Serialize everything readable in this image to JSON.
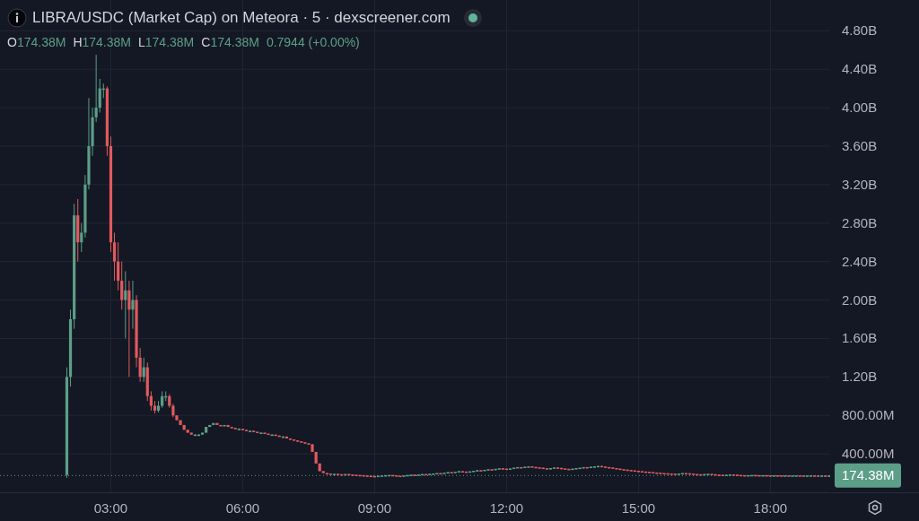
{
  "header": {
    "title": "LIBRA/USDC (Market Cap) on Meteora · 5 · dexscreener.com",
    "ohlc": [
      {
        "label": "O",
        "value": "174.38M"
      },
      {
        "label": "H",
        "value": "174.38M"
      },
      {
        "label": "L",
        "value": "174.38M"
      },
      {
        "label": "C",
        "value": "174.38M"
      }
    ],
    "change": "0.7944 (+0.00%)"
  },
  "price_badge": "174.38M",
  "chart_data": {
    "type": "candlestick",
    "xlim": [
      0.48,
      21.38
    ],
    "grid": true,
    "ylim": [
      0,
      5120000000.0
    ],
    "xticks": [
      {
        "value": 3,
        "label": "03:00"
      },
      {
        "value": 6,
        "label": "06:00"
      },
      {
        "value": 9,
        "label": "09:00"
      },
      {
        "value": 12,
        "label": "12:00"
      },
      {
        "value": 15,
        "label": "15:00"
      },
      {
        "value": 18,
        "label": "18:00"
      }
    ],
    "yticks": [
      {
        "value": 400000000.0,
        "label": "400.00M"
      },
      {
        "value": 800000000.0,
        "label": "800.00M"
      },
      {
        "value": 1200000000.0,
        "label": "1.20B"
      },
      {
        "value": 1600000000.0,
        "label": "1.60B"
      },
      {
        "value": 2000000000.0,
        "label": "2.00B"
      },
      {
        "value": 2400000000.0,
        "label": "2.40B"
      },
      {
        "value": 2800000000.0,
        "label": "2.80B"
      },
      {
        "value": 3200000000.0,
        "label": "3.20B"
      },
      {
        "value": 3600000000.0,
        "label": "3.60B"
      },
      {
        "value": 4000000000.0,
        "label": "4.00B"
      },
      {
        "value": 4400000000.0,
        "label": "4.40B"
      },
      {
        "value": 4800000000.0,
        "label": "4.80B"
      }
    ],
    "x": [
      2,
      2.083,
      2.167,
      2.25,
      2.333,
      2.417,
      2.5,
      2.583,
      2.667,
      2.75,
      2.833,
      2.917,
      3,
      3.083,
      3.167,
      3.25,
      3.333,
      3.417,
      3.5,
      3.583,
      3.667,
      3.75,
      3.833,
      3.917,
      4,
      4.083,
      4.167,
      4.25,
      4.333,
      4.417,
      4.5,
      4.583,
      4.667,
      4.75,
      4.833,
      4.917,
      5,
      5.083,
      5.167,
      5.25,
      5.333,
      5.417,
      5.5,
      5.583,
      5.667,
      5.75,
      5.833,
      5.917,
      6,
      6.083,
      6.167,
      6.25,
      6.333,
      6.417,
      6.5,
      6.583,
      6.667,
      6.75,
      6.833,
      6.917,
      7,
      7.083,
      7.167,
      7.25,
      7.333,
      7.417,
      7.5,
      7.583,
      7.667,
      7.75,
      7.833,
      7.917,
      8,
      8.083,
      8.167,
      8.25,
      8.333,
      8.417,
      8.5,
      8.583,
      8.667,
      8.75,
      8.833,
      8.917,
      9,
      9.083,
      9.167,
      9.25,
      9.333,
      9.417,
      9.5,
      9.583,
      9.667,
      9.75,
      9.833,
      9.917,
      10,
      10.083,
      10.167,
      10.25,
      10.333,
      10.417,
      10.5,
      10.583,
      10.667,
      10.75,
      10.833,
      10.917,
      11,
      11.083,
      11.167,
      11.25,
      11.333,
      11.417,
      11.5,
      11.583,
      11.667,
      11.75,
      11.833,
      11.917,
      12,
      12.083,
      12.167,
      12.25,
      12.333,
      12.417,
      12.5,
      12.583,
      12.667,
      12.75,
      12.833,
      12.917,
      13,
      13.083,
      13.167,
      13.25,
      13.333,
      13.417,
      13.5,
      13.583,
      13.667,
      13.75,
      13.833,
      13.917,
      14,
      14.083,
      14.167,
      14.25,
      14.333,
      14.417,
      14.5,
      14.583,
      14.667,
      14.75,
      14.833,
      14.917,
      15,
      15.083,
      15.167,
      15.25,
      15.333,
      15.417,
      15.5,
      15.583,
      15.667,
      15.75,
      15.833,
      15.917,
      16,
      16.083,
      16.167,
      16.25,
      16.333,
      16.417,
      16.5,
      16.583,
      16.667,
      16.75,
      16.833,
      16.917,
      17,
      17.083,
      17.167,
      17.25,
      17.333,
      17.417,
      17.5,
      17.583,
      17.667,
      17.75,
      17.833,
      17.917,
      18,
      18.083,
      18.167,
      18.25,
      18.333,
      18.417,
      18.5,
      18.583,
      18.667,
      18.75,
      18.833,
      18.917,
      19,
      19.083,
      19.167,
      19.25,
      19.333
    ],
    "ohlc": [
      [
        180000000.0,
        1300000000.0,
        150000000.0,
        1200000000.0
      ],
      [
        1200000000.0,
        1900000000.0,
        1100000000.0,
        1800000000.0
      ],
      [
        1800000000.0,
        3000000000.0,
        1700000000.0,
        2880000000.0
      ],
      [
        2880000000.0,
        3050000000.0,
        2400000000.0,
        2600000000.0
      ],
      [
        2600000000.0,
        2800000000.0,
        2500000000.0,
        2700000000.0
      ],
      [
        2700000000.0,
        3300000000.0,
        2650000000.0,
        3200000000.0
      ],
      [
        3200000000.0,
        4100000000.0,
        3150000000.0,
        3600000000.0
      ],
      [
        3600000000.0,
        4000000000.0,
        3500000000.0,
        3900000000.0
      ],
      [
        3900000000.0,
        4550000000.0,
        3850000000.0,
        4000000000.0
      ],
      [
        4000000000.0,
        4300000000.0,
        3950000000.0,
        4200000000.0
      ],
      [
        4200000000.0,
        4250000000.0,
        4100000000.0,
        4200000000.0
      ],
      [
        4200000000.0,
        4220000000.0,
        3500000000.0,
        3600000000.0
      ],
      [
        3600000000.0,
        3700000000.0,
        2500000000.0,
        2600000000.0
      ],
      [
        2600000000.0,
        2700000000.0,
        2200000000.0,
        2400000000.0
      ],
      [
        2400000000.0,
        2600000000.0,
        2100000000.0,
        2200000000.0
      ],
      [
        2200000000.0,
        2400000000.0,
        1900000000.0,
        2000000000.0
      ],
      [
        2000000000.0,
        2300000000.0,
        1600000000.0,
        2100000000.0
      ],
      [
        2100000000.0,
        2200000000.0,
        1200000000.0,
        1900000000.0
      ],
      [
        1900000000.0,
        2200000000.0,
        1700000000.0,
        2000000000.0
      ],
      [
        2000000000.0,
        2050000000.0,
        1300000000.0,
        1400000000.0
      ],
      [
        1400000000.0,
        1500000000.0,
        1150000000.0,
        1200000000.0
      ],
      [
        1200000000.0,
        1400000000.0,
        1150000000.0,
        1300000000.0
      ],
      [
        1300000000.0,
        1350000000.0,
        950000000.0,
        1000000000.0
      ],
      [
        1000000000.0,
        1050000000.0,
        850000000.0,
        900000000.0
      ],
      [
        900000000.0,
        950000000.0,
        820000000.0,
        850000000.0
      ],
      [
        850000000.0,
        950000000.0,
        830000000.0,
        900000000.0
      ],
      [
        900000000.0,
        1050000000.0,
        880000000.0,
        1000000000.0
      ],
      [
        1000000000.0,
        1050000000.0,
        950000000.0,
        1000000000.0
      ],
      [
        1000000000.0,
        1020000000.0,
        880000000.0,
        900000000.0
      ],
      [
        900000000.0,
        920000000.0,
        780000000.0,
        800000000.0
      ],
      [
        800000000.0,
        800000000.0,
        750000000.0,
        750000000.0
      ],
      [
        750000000.0,
        750000000.0,
        700000000.0,
        700000000.0
      ],
      [
        700000000.0,
        700000000.0,
        650000000.0,
        650000000.0
      ],
      [
        650000000.0,
        650000000.0,
        620000000.0,
        620000000.0
      ],
      [
        620000000.0,
        620000000.0,
        600000000.0,
        600000000.0
      ],
      [
        600000000.0,
        605000000.0,
        595000000.0,
        600000000.0
      ],
      [
        600000000.0,
        605000000.0,
        595000000.0,
        600000000.0
      ],
      [
        600000000.0,
        620000000.0,
        600000000.0,
        620000000.0
      ],
      [
        620000000.0,
        680000000.0,
        620000000.0,
        680000000.0
      ],
      [
        680000000.0,
        700000000.0,
        680000000.0,
        700000000.0
      ],
      [
        700000000.0,
        720000000.0,
        700000000.0,
        720000000.0
      ],
      [
        720000000.0,
        720000000.0,
        700000000.0,
        700000000.0
      ],
      [
        700000000.0,
        700000000.0,
        690000000.0,
        690000000.0
      ],
      [
        690000000.0,
        700000000.0,
        690000000.0,
        700000000.0
      ],
      [
        700000000.0,
        700000000.0,
        680000000.0,
        680000000.0
      ],
      [
        680000000.0,
        680000000.0,
        670000000.0,
        670000000.0
      ],
      [
        670000000.0,
        670000000.0,
        660000000.0,
        660000000.0
      ],
      [
        660000000.0,
        665000000.0,
        655000000.0,
        660000000.0
      ],
      [
        660000000.0,
        660000000.0,
        650000000.0,
        650000000.0
      ],
      [
        650000000.0,
        650000000.0,
        640000000.0,
        640000000.0
      ],
      [
        640000000.0,
        645000000.0,
        635000000.0,
        640000000.0
      ],
      [
        640000000.0,
        640000000.0,
        630000000.0,
        630000000.0
      ],
      [
        630000000.0,
        630000000.0,
        620000000.0,
        620000000.0
      ],
      [
        620000000.0,
        625000000.0,
        615000000.0,
        620000000.0
      ],
      [
        620000000.0,
        620000000.0,
        610000000.0,
        610000000.0
      ],
      [
        610000000.0,
        610000000.0,
        600000000.0,
        600000000.0
      ],
      [
        600000000.0,
        605000000.0,
        595000000.0,
        600000000.0
      ],
      [
        600000000.0,
        600000000.0,
        590000000.0,
        590000000.0
      ],
      [
        590000000.0,
        590000000.0,
        580000000.0,
        580000000.0
      ],
      [
        580000000.0,
        585000000.0,
        575000000.0,
        580000000.0
      ],
      [
        580000000.0,
        580000000.0,
        560000000.0,
        560000000.0
      ],
      [
        560000000.0,
        560000000.0,
        550000000.0,
        550000000.0
      ],
      [
        550000000.0,
        550000000.0,
        540000000.0,
        540000000.0
      ],
      [
        540000000.0,
        540000000.0,
        530000000.0,
        530000000.0
      ],
      [
        530000000.0,
        530000000.0,
        520000000.0,
        520000000.0
      ],
      [
        520000000.0,
        520000000.0,
        510000000.0,
        510000000.0
      ],
      [
        510000000.0,
        510000000.0,
        500000000.0,
        500000000.0
      ],
      [
        500000000.0,
        500000000.0,
        420000000.0,
        420000000.0
      ],
      [
        420000000.0,
        420000000.0,
        300000000.0,
        300000000.0
      ],
      [
        300000000.0,
        300000000.0,
        220000000.0,
        220000000.0
      ],
      [
        220000000.0,
        220000000.0,
        200000000.0,
        200000000.0
      ],
      [
        200000000.0,
        200000000.0,
        195000000.0,
        195000000.0
      ],
      [
        195000000.0,
        195000000.0,
        190000000.0,
        190000000.0
      ],
      [
        190000000.0,
        192000000.0,
        190000000.0,
        192000000.0
      ],
      [
        192000000.0,
        192000000.0,
        188000000.0,
        188000000.0
      ],
      [
        188000000.0,
        188000000.0,
        185000000.0,
        185000000.0
      ],
      [
        185000000.0,
        190000000.0,
        185000000.0,
        190000000.0
      ],
      [
        190000000.0,
        190000000.0,
        186000000.0,
        186000000.0
      ],
      [
        186000000.0,
        186000000.0,
        182000000.0,
        182000000.0
      ],
      [
        182000000.0,
        182000000.0,
        180000000.0,
        180000000.0
      ],
      [
        180000000.0,
        180000000.0,
        178000000.0,
        178000000.0
      ],
      [
        178000000.0,
        178000000.0,
        175000000.0,
        175000000.0
      ],
      [
        175000000.0,
        175000000.0,
        172000000.0,
        172000000.0
      ],
      [
        172000000.0,
        172000000.0,
        170000000.0,
        170000000.0
      ],
      [
        170000000.0,
        170000000.0,
        168000000.0,
        168000000.0
      ],
      [
        168000000.0,
        172000000.0,
        168000000.0,
        172000000.0
      ],
      [
        172000000.0,
        175000000.0,
        172000000.0,
        175000000.0
      ],
      [
        175000000.0,
        178000000.0,
        175000000.0,
        178000000.0
      ],
      [
        178000000.0,
        180000000.0,
        178000000.0,
        180000000.0
      ],
      [
        180000000.0,
        180000000.0,
        176000000.0,
        176000000.0
      ],
      [
        176000000.0,
        176000000.0,
        172000000.0,
        172000000.0
      ],
      [
        172000000.0,
        172000000.0,
        170000000.0,
        170000000.0
      ],
      [
        170000000.0,
        175000000.0,
        170000000.0,
        175000000.0
      ],
      [
        175000000.0,
        180000000.0,
        175000000.0,
        180000000.0
      ],
      [
        180000000.0,
        184000000.0,
        180000000.0,
        184000000.0
      ],
      [
        184000000.0,
        184000000.0,
        182000000.0,
        182000000.0
      ],
      [
        182000000.0,
        186000000.0,
        182000000.0,
        186000000.0
      ],
      [
        186000000.0,
        190000000.0,
        186000000.0,
        190000000.0
      ],
      [
        190000000.0,
        190000000.0,
        188000000.0,
        188000000.0
      ],
      [
        188000000.0,
        192000000.0,
        188000000.0,
        192000000.0
      ],
      [
        192000000.0,
        196000000.0,
        192000000.0,
        196000000.0
      ],
      [
        196000000.0,
        200000000.0,
        196000000.0,
        200000000.0
      ],
      [
        200000000.0,
        200000000.0,
        198000000.0,
        198000000.0
      ],
      [
        198000000.0,
        204000000.0,
        198000000.0,
        204000000.0
      ],
      [
        204000000.0,
        210000000.0,
        204000000.0,
        210000000.0
      ],
      [
        210000000.0,
        210000000.0,
        208000000.0,
        208000000.0
      ],
      [
        208000000.0,
        214000000.0,
        208000000.0,
        214000000.0
      ],
      [
        214000000.0,
        220000000.0,
        214000000.0,
        220000000.0
      ],
      [
        220000000.0,
        220000000.0,
        216000000.0,
        216000000.0
      ],
      [
        216000000.0,
        216000000.0,
        212000000.0,
        212000000.0
      ],
      [
        212000000.0,
        218000000.0,
        212000000.0,
        218000000.0
      ],
      [
        218000000.0,
        224000000.0,
        218000000.0,
        224000000.0
      ],
      [
        224000000.0,
        230000000.0,
        224000000.0,
        230000000.0
      ],
      [
        230000000.0,
        230000000.0,
        226000000.0,
        226000000.0
      ],
      [
        226000000.0,
        234000000.0,
        226000000.0,
        234000000.0
      ],
      [
        234000000.0,
        240000000.0,
        234000000.0,
        240000000.0
      ],
      [
        240000000.0,
        240000000.0,
        236000000.0,
        236000000.0
      ],
      [
        236000000.0,
        244000000.0,
        236000000.0,
        244000000.0
      ],
      [
        244000000.0,
        250000000.0,
        244000000.0,
        250000000.0
      ],
      [
        250000000.0,
        250000000.0,
        246000000.0,
        246000000.0
      ],
      [
        246000000.0,
        246000000.0,
        240000000.0,
        240000000.0
      ],
      [
        240000000.0,
        248000000.0,
        240000000.0,
        248000000.0
      ],
      [
        248000000.0,
        256000000.0,
        248000000.0,
        256000000.0
      ],
      [
        256000000.0,
        262000000.0,
        256000000.0,
        262000000.0
      ],
      [
        262000000.0,
        262000000.0,
        258000000.0,
        258000000.0
      ],
      [
        258000000.0,
        266000000.0,
        258000000.0,
        266000000.0
      ],
      [
        266000000.0,
        270000000.0,
        266000000.0,
        270000000.0
      ],
      [
        270000000.0,
        270000000.0,
        264000000.0,
        264000000.0
      ],
      [
        264000000.0,
        264000000.0,
        260000000.0,
        260000000.0
      ],
      [
        260000000.0,
        260000000.0,
        256000000.0,
        256000000.0
      ],
      [
        256000000.0,
        256000000.0,
        250000000.0,
        250000000.0
      ],
      [
        250000000.0,
        250000000.0,
        246000000.0,
        246000000.0
      ],
      [
        246000000.0,
        252000000.0,
        246000000.0,
        252000000.0
      ],
      [
        252000000.0,
        258000000.0,
        252000000.0,
        258000000.0
      ],
      [
        258000000.0,
        258000000.0,
        254000000.0,
        254000000.0
      ],
      [
        254000000.0,
        254000000.0,
        248000000.0,
        248000000.0
      ],
      [
        248000000.0,
        248000000.0,
        244000000.0,
        244000000.0
      ],
      [
        244000000.0,
        244000000.0,
        240000000.0,
        240000000.0
      ],
      [
        240000000.0,
        246000000.0,
        240000000.0,
        246000000.0
      ],
      [
        246000000.0,
        252000000.0,
        246000000.0,
        252000000.0
      ],
      [
        252000000.0,
        256000000.0,
        252000000.0,
        256000000.0
      ],
      [
        256000000.0,
        262000000.0,
        256000000.0,
        262000000.0
      ],
      [
        262000000.0,
        262000000.0,
        260000000.0,
        260000000.0
      ],
      [
        260000000.0,
        266000000.0,
        260000000.0,
        266000000.0
      ],
      [
        266000000.0,
        270000000.0,
        266000000.0,
        270000000.0
      ],
      [
        270000000.0,
        274000000.0,
        270000000.0,
        274000000.0
      ],
      [
        274000000.0,
        274000000.0,
        268000000.0,
        268000000.0
      ],
      [
        268000000.0,
        268000000.0,
        262000000.0,
        262000000.0
      ],
      [
        262000000.0,
        262000000.0,
        258000000.0,
        258000000.0
      ],
      [
        258000000.0,
        258000000.0,
        252000000.0,
        252000000.0
      ],
      [
        252000000.0,
        252000000.0,
        246000000.0,
        246000000.0
      ],
      [
        246000000.0,
        246000000.0,
        240000000.0,
        240000000.0
      ],
      [
        240000000.0,
        240000000.0,
        236000000.0,
        236000000.0
      ],
      [
        236000000.0,
        236000000.0,
        232000000.0,
        232000000.0
      ],
      [
        232000000.0,
        232000000.0,
        228000000.0,
        228000000.0
      ],
      [
        228000000.0,
        228000000.0,
        224000000.0,
        224000000.0
      ],
      [
        224000000.0,
        224000000.0,
        220000000.0,
        220000000.0
      ],
      [
        220000000.0,
        220000000.0,
        216000000.0,
        216000000.0
      ],
      [
        216000000.0,
        216000000.0,
        214000000.0,
        214000000.0
      ],
      [
        214000000.0,
        214000000.0,
        210000000.0,
        210000000.0
      ],
      [
        210000000.0,
        210000000.0,
        206000000.0,
        206000000.0
      ],
      [
        206000000.0,
        206000000.0,
        204000000.0,
        204000000.0
      ],
      [
        204000000.0,
        204000000.0,
        200000000.0,
        200000000.0
      ],
      [
        200000000.0,
        200000000.0,
        198000000.0,
        198000000.0
      ],
      [
        198000000.0,
        198000000.0,
        196000000.0,
        196000000.0
      ],
      [
        196000000.0,
        196000000.0,
        194000000.0,
        194000000.0
      ],
      [
        194000000.0,
        194000000.0,
        192000000.0,
        192000000.0
      ],
      [
        192000000.0,
        196000000.0,
        192000000.0,
        196000000.0
      ],
      [
        196000000.0,
        200000000.0,
        196000000.0,
        200000000.0
      ],
      [
        200000000.0,
        200000000.0,
        198000000.0,
        198000000.0
      ],
      [
        198000000.0,
        198000000.0,
        194000000.0,
        194000000.0
      ],
      [
        194000000.0,
        194000000.0,
        190000000.0,
        190000000.0
      ],
      [
        190000000.0,
        190000000.0,
        188000000.0,
        188000000.0
      ],
      [
        188000000.0,
        188000000.0,
        186000000.0,
        186000000.0
      ],
      [
        186000000.0,
        190000000.0,
        186000000.0,
        190000000.0
      ],
      [
        190000000.0,
        192000000.0,
        190000000.0,
        192000000.0
      ],
      [
        192000000.0,
        192000000.0,
        188000000.0,
        188000000.0
      ],
      [
        188000000.0,
        188000000.0,
        184000000.0,
        184000000.0
      ],
      [
        184000000.0,
        184000000.0,
        182000000.0,
        182000000.0
      ],
      [
        182000000.0,
        182000000.0,
        180000000.0,
        180000000.0
      ],
      [
        180000000.0,
        182000000.0,
        180000000.0,
        182000000.0
      ],
      [
        182000000.0,
        186000000.0,
        182000000.0,
        186000000.0
      ],
      [
        186000000.0,
        186000000.0,
        184000000.0,
        184000000.0
      ],
      [
        184000000.0,
        184000000.0,
        180000000.0,
        180000000.0
      ],
      [
        180000000.0,
        180000000.0,
        178000000.0,
        178000000.0
      ],
      [
        178000000.0,
        178000000.0,
        176000000.0,
        176000000.0
      ],
      [
        176000000.0,
        178000000.0,
        176000000.0,
        178000000.0
      ],
      [
        178000000.0,
        180000000.0,
        178000000.0,
        180000000.0
      ],
      [
        180000000.0,
        180000000.0,
        178000000.0,
        178000000.0
      ],
      [
        178000000.0,
        178000000.0,
        176000000.0,
        176000000.0
      ],
      [
        176000000.0,
        178000000.0,
        176000000.0,
        178000000.0
      ],
      [
        178000000.0,
        178000000.0,
        176000000.0,
        176000000.0
      ],
      [
        176000000.0,
        176000000.0,
        175000000.0,
        175000000.0
      ],
      [
        175000000.0,
        177000000.0,
        175000000.0,
        177000000.0
      ],
      [
        177000000.0,
        177000000.0,
        176000000.0,
        176000000.0
      ],
      [
        176000000.0,
        176000000.0,
        175000000.0,
        175000000.0
      ],
      [
        175000000.0,
        176000000.0,
        175000000.0,
        176000000.0
      ],
      [
        176000000.0,
        176000000.0,
        174000000.0,
        174000000.0
      ],
      [
        174000000.0,
        175000000.0,
        174000000.0,
        175000000.0
      ],
      [
        175000000.0,
        176000000.0,
        175000000.0,
        176000000.0
      ],
      [
        176000000.0,
        176000000.0,
        175000000.0,
        175000000.0
      ],
      [
        175000000.0,
        175000000.0,
        174000000.0,
        174000000.0
      ],
      [
        174000000.0,
        175000000.0,
        174000000.0,
        175000000.0
      ],
      [
        175000000.0,
        176000000.0,
        175000000.0,
        176000000.0
      ],
      [
        176000000.0,
        176000000.0,
        175000000.0,
        175000000.0
      ],
      [
        175000000.0,
        175000000.0,
        174000000.0,
        174000000.0
      ],
      [
        174000000.0,
        175000000.0,
        174000000.0,
        175000000.0
      ],
      [
        175000000.0,
        175000000.0,
        174000000.0,
        174000000.0
      ],
      [
        174000000.0,
        174380000.0,
        174000000.0,
        174380000.0
      ]
    ]
  }
}
